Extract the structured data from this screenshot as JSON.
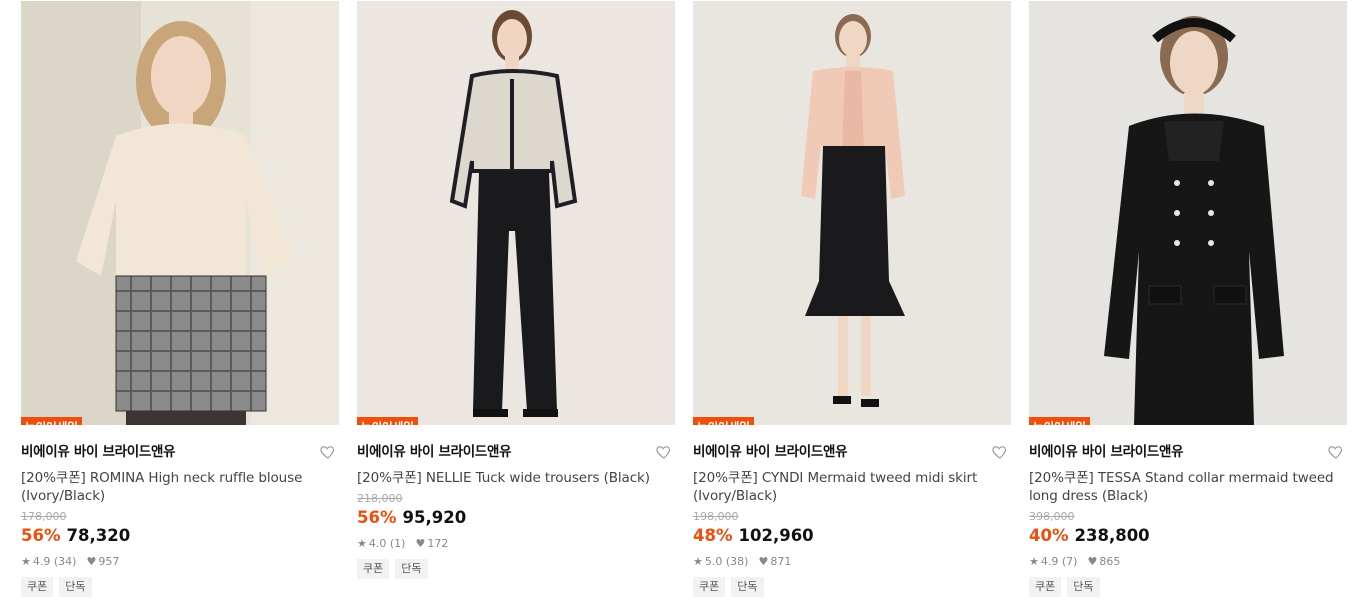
{
  "products": [
    {
      "badge": "뉴이어세일",
      "brand": "비에이유 바이 브라이드앤유",
      "name": "[20%쿠폰] ROMINA High neck ruffle blouse (Ivory/Black)",
      "original_price": "178,000",
      "discount": "56%",
      "price": "78,320",
      "rating": "4.9",
      "reviews": "(34)",
      "likes": "957",
      "tags": [
        "쿠폰",
        "단독"
      ]
    },
    {
      "badge": "뉴이어세일",
      "brand": "비에이유 바이 브라이드앤유",
      "name": "[20%쿠폰] NELLIE Tuck wide trousers (Black)",
      "original_price": "218,000",
      "discount": "56%",
      "price": "95,920",
      "rating": "4.0",
      "reviews": "(1)",
      "likes": "172",
      "tags": [
        "쿠폰",
        "단독"
      ]
    },
    {
      "badge": "뉴이어세일",
      "brand": "비에이유 바이 브라이드앤유",
      "name": "[20%쿠폰] CYNDI Mermaid tweed midi skirt (Ivory/Black)",
      "original_price": "198,000",
      "discount": "48%",
      "price": "102,960",
      "rating": "5.0",
      "reviews": "(38)",
      "likes": "871",
      "tags": [
        "쿠폰",
        "단독"
      ]
    },
    {
      "badge": "뉴이어세일",
      "brand": "비에이유 바이 브라이드앤유",
      "name": "[20%쿠폰] TESSA Stand collar mermaid tweed long dress (Black)",
      "original_price": "398,000",
      "discount": "40%",
      "price": "238,800",
      "rating": "4.9",
      "reviews": "(7)",
      "likes": "865",
      "tags": [
        "쿠폰",
        "단독"
      ]
    }
  ],
  "colors": {
    "accent": "#f04e0c",
    "tag_bg": "#f2f2f2"
  },
  "icons": {
    "wishlist": "heart-outline-icon",
    "rating": "star-icon",
    "likes": "heart-filled-icon"
  }
}
